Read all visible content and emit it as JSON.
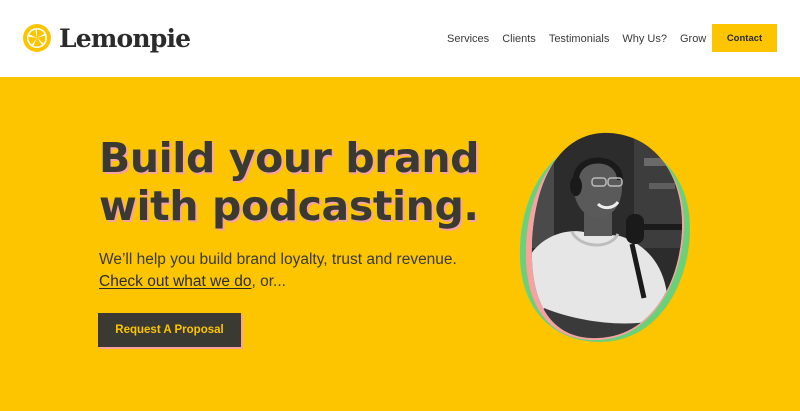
{
  "header": {
    "logo": {
      "text": "Lemonpie",
      "icon": "lemon-slice-icon"
    },
    "nav": [
      {
        "label": "Services"
      },
      {
        "label": "Clients"
      },
      {
        "label": "Testimonials"
      },
      {
        "label": "Why Us?"
      },
      {
        "label": "Grow"
      }
    ],
    "contact_label": "Contact"
  },
  "hero": {
    "title_line1": "Build your brand",
    "title_line2": "with podcasting.",
    "subtitle": "We’ll help you build brand loyalty, trust and revenue.",
    "link_text": "Check out what we do",
    "after_link": ", or...",
    "cta_label": "Request A Proposal",
    "image": "podcaster-photo"
  },
  "colors": {
    "brand_yellow": "#fcc500",
    "dark": "#3a3a33",
    "accent_pink": "#f7a2a0",
    "white": "#ffffff"
  }
}
